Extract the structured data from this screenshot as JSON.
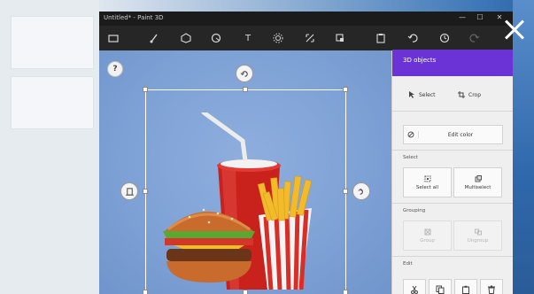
{
  "window": {
    "title": "Untitled* - Paint 3D",
    "controls": {
      "minimize": "—",
      "maximize": "☐",
      "close": "✕"
    }
  },
  "toolbar": {
    "items": [
      {
        "icon": "menu-folder-icon"
      },
      {
        "icon": "brush-icon"
      },
      {
        "icon": "3d-shapes-icon"
      },
      {
        "icon": "stickers-icon"
      },
      {
        "icon": "text-icon",
        "glyph": "T"
      },
      {
        "icon": "effects-icon"
      },
      {
        "icon": "canvas-icon"
      },
      {
        "icon": "remix-3d-icon"
      },
      {
        "icon": "paste-icon"
      },
      {
        "icon": "undo-icon"
      },
      {
        "icon": "history-icon"
      },
      {
        "icon": "redo-icon"
      }
    ]
  },
  "canvas": {
    "help_label": "?",
    "image": "3d-fast-food-model: burger, soda cup with straw, french fries"
  },
  "panel": {
    "header": "3D objects",
    "tabs": [
      {
        "label": "Select",
        "icon": "cursor-icon"
      },
      {
        "label": "Crop",
        "icon": "crop-icon"
      }
    ],
    "edit_color": "Edit color",
    "sections": {
      "select": {
        "title": "Select",
        "buttons": [
          {
            "label": "Select all",
            "icon": "select-all-icon",
            "enabled": true
          },
          {
            "label": "Multiselect",
            "icon": "multiselect-icon",
            "enabled": true
          }
        ]
      },
      "grouping": {
        "title": "Grouping",
        "buttons": [
          {
            "label": "Group",
            "icon": "group-icon",
            "enabled": false
          },
          {
            "label": "Ungroup",
            "icon": "ungroup-icon",
            "enabled": false
          }
        ]
      },
      "edit": {
        "title": "Edit",
        "buttons": [
          {
            "icon": "cut-icon"
          },
          {
            "icon": "copy-icon"
          },
          {
            "icon": "paste-icon"
          },
          {
            "icon": "delete-icon"
          }
        ]
      }
    }
  },
  "colors": {
    "panel_accent": "#6b33d6",
    "canvas_bg": "#7fa2d6",
    "toolbar_bg": "#262626"
  }
}
